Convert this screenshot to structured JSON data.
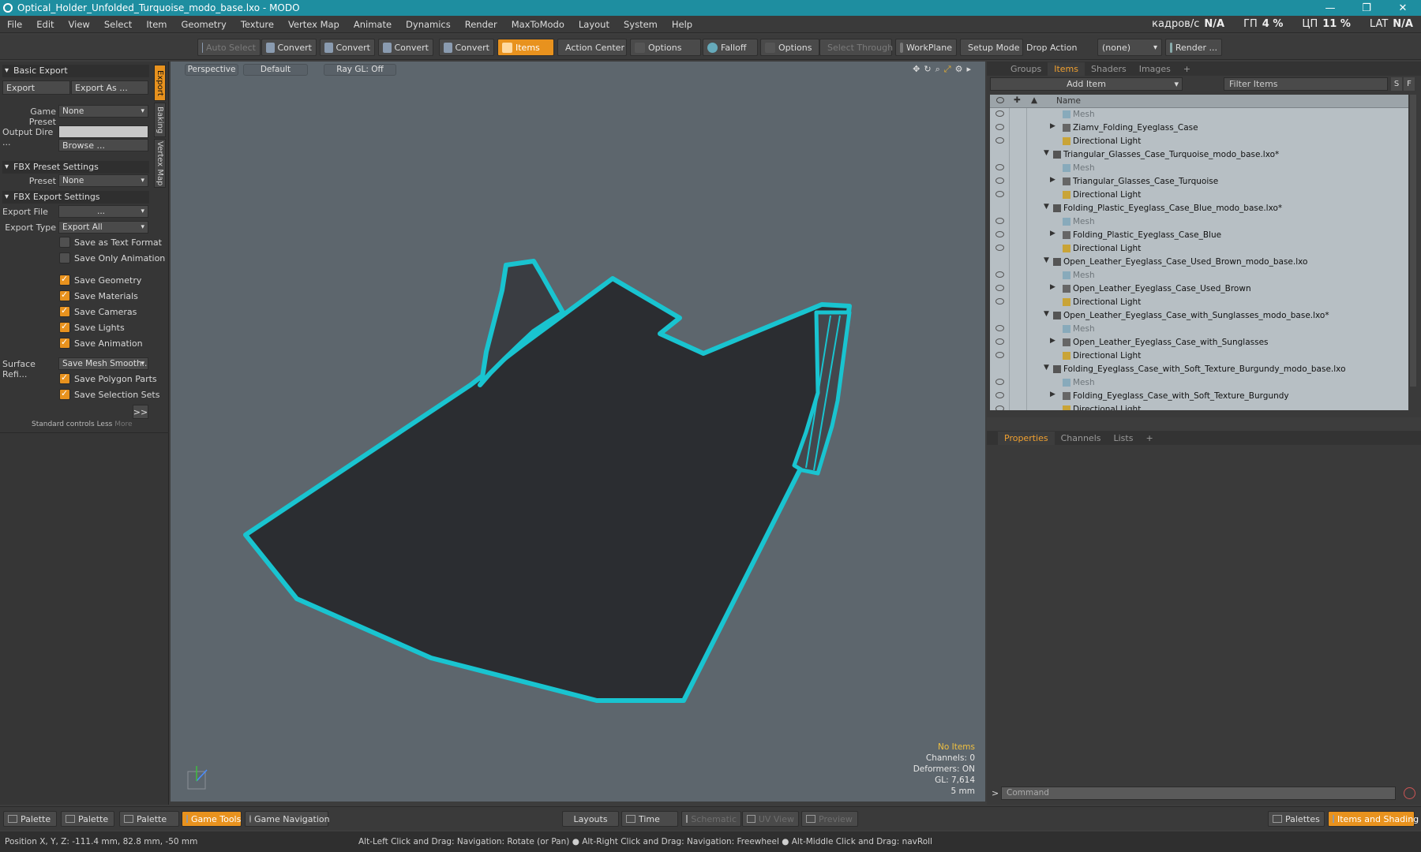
{
  "window": {
    "title": "Optical_Holder_Unfolded_Turquoise_modo_base.lxo - MODO",
    "minimize": "—",
    "maximize": "❐",
    "close": "✕"
  },
  "menu": [
    "File",
    "Edit",
    "View",
    "Select",
    "Item",
    "Geometry",
    "Texture",
    "Vertex Map",
    "Animate",
    "Dynamics",
    "Render",
    "MaxToModo",
    "Layout",
    "System",
    "Help"
  ],
  "stats": {
    "fps_label": "кадров/с",
    "fps_value": "N/A",
    "gpu_label": "ГП",
    "gpu_value": "4 %",
    "cpu_label": "ЦП",
    "cpu_value": "11 %",
    "lat_label": "LAT",
    "lat_value": "N/A"
  },
  "toolbar": {
    "auto_select": "Auto Select",
    "convert": "Convert",
    "items": "Items",
    "action_center": "Action Center",
    "options": "Options",
    "falloff": "Falloff",
    "select_through": "Select Through",
    "workplane": "WorkPlane",
    "setup_mode": "Setup Mode",
    "drop_action": "Drop Action",
    "drop_value": "(none)",
    "render": "Render ..."
  },
  "left": {
    "vtabs": [
      "Export",
      "Baking",
      "Vertex Map"
    ],
    "basic_export": "Basic Export",
    "export": "Export",
    "export_as": "Export As ...",
    "game_preset_label": "Game Preset",
    "game_preset_value": "None",
    "output_dir_label": "Output Dire ...",
    "browse": "Browse ...",
    "fbx_preset": "FBX Preset Settings",
    "preset_label": "Preset",
    "preset_value": "None",
    "fbx_export": "FBX Export Settings",
    "export_file_label": "Export File",
    "export_file_value": "...",
    "export_type_label": "Export Type",
    "export_type_value": "Export All",
    "checks": [
      {
        "label": "Save as Text Format",
        "checked": false
      },
      {
        "label": "Save Only Animation",
        "checked": false
      },
      {
        "label": "Save Geometry",
        "checked": true
      },
      {
        "label": "Save Materials",
        "checked": true
      },
      {
        "label": "Save Cameras",
        "checked": true
      },
      {
        "label": "Save Lights",
        "checked": true
      },
      {
        "label": "Save Animation",
        "checked": true
      }
    ],
    "surface_label": "Surface Refi...",
    "surface_value": "Save Mesh Smooth...",
    "checks2": [
      {
        "label": "Save Polygon Parts",
        "checked": true
      },
      {
        "label": "Save Selection Sets",
        "checked": true
      }
    ],
    "more_btn": ">>",
    "standard_controls": "Standard controls",
    "less": "Less",
    "more": "More"
  },
  "viewport": {
    "perspective": "Perspective",
    "default": "Default",
    "raygl": "Ray GL: Off",
    "info": {
      "no_items": "No Items",
      "channels": "Channels: 0",
      "deformers": "Deformers: ON",
      "gl": "GL: 7,614",
      "scale": "5 mm"
    }
  },
  "colors": {
    "accent": "#e8921e",
    "turquoise": "#19c4d0",
    "titlebar": "#1e8ea0",
    "viewport_bg": "#5d666d",
    "mesh_fill": "#2b2d31"
  },
  "items_panel": {
    "tabs": [
      "Groups",
      "Items",
      "Shaders",
      "Images",
      "+"
    ],
    "add_item": "Add Item",
    "filter": "Filter Items",
    "s": "S",
    "f": "F",
    "name_header": "Name",
    "rows": [
      {
        "type": "mesh",
        "indent": 1,
        "text": "Mesh"
      },
      {
        "type": "group",
        "indent": 1,
        "text": "Ziamv_Folding_Eyeglass_Case"
      },
      {
        "type": "light",
        "indent": 1,
        "text": "Directional Light"
      },
      {
        "type": "scene",
        "indent": 0,
        "text": "Triangular_Glasses_Case_Turquoise_modo_base.lxo*"
      },
      {
        "type": "mesh",
        "indent": 1,
        "text": "Mesh"
      },
      {
        "type": "group",
        "indent": 1,
        "text": "Triangular_Glasses_Case_Turquoise"
      },
      {
        "type": "light",
        "indent": 1,
        "text": "Directional Light"
      },
      {
        "type": "scene",
        "indent": 0,
        "text": "Folding_Plastic_Eyeglass_Case_Blue_modo_base.lxo*"
      },
      {
        "type": "mesh",
        "indent": 1,
        "text": "Mesh"
      },
      {
        "type": "group",
        "indent": 1,
        "text": "Folding_Plastic_Eyeglass_Case_Blue"
      },
      {
        "type": "light",
        "indent": 1,
        "text": "Directional Light"
      },
      {
        "type": "scene",
        "indent": 0,
        "text": "Open_Leather_Eyeglass_Case_Used_Brown_modo_base.lxo"
      },
      {
        "type": "mesh",
        "indent": 1,
        "text": "Mesh"
      },
      {
        "type": "group",
        "indent": 1,
        "text": "Open_Leather_Eyeglass_Case_Used_Brown"
      },
      {
        "type": "light",
        "indent": 1,
        "text": "Directional Light"
      },
      {
        "type": "scene",
        "indent": 0,
        "text": "Open_Leather_Eyeglass_Case_with_Sunglasses_modo_base.lxo*"
      },
      {
        "type": "mesh",
        "indent": 1,
        "text": "Mesh"
      },
      {
        "type": "group",
        "indent": 1,
        "text": "Open_Leather_Eyeglass_Case_with_Sunglasses"
      },
      {
        "type": "light",
        "indent": 1,
        "text": "Directional Light"
      },
      {
        "type": "scene",
        "indent": 0,
        "text": "Folding_Eyeglass_Case_with_Soft_Texture_Burgundy_modo_base.lxo"
      },
      {
        "type": "mesh",
        "indent": 1,
        "text": "Mesh"
      },
      {
        "type": "group",
        "indent": 1,
        "text": "Folding_Eyeglass_Case_with_Soft_Texture_Burgundy"
      },
      {
        "type": "light",
        "indent": 1,
        "text": "Directional Light"
      }
    ]
  },
  "props_panel": {
    "tabs": [
      "Properties",
      "Channels",
      "Lists",
      "+"
    ],
    "command_prompt": ">",
    "command_placeholder": "Command"
  },
  "bottom": {
    "palette": "Palette",
    "game_tools": "Game Tools",
    "game_navigation": "Game Navigation",
    "layouts": "Layouts",
    "time": "Time",
    "schematic": "Schematic",
    "uv_view": "UV View",
    "preview": "Preview",
    "palettes": "Palettes",
    "items_shading": "Items and Shading"
  },
  "status": {
    "position": "Position X, Y, Z:  -111.4 mm, 82.8 mm, -50 mm",
    "hint": "Alt-Left Click and Drag: Navigation: Rotate (or Pan) ● Alt-Right Click and Drag: Navigation: Freewheel ● Alt-Middle Click and Drag: navRoll"
  }
}
